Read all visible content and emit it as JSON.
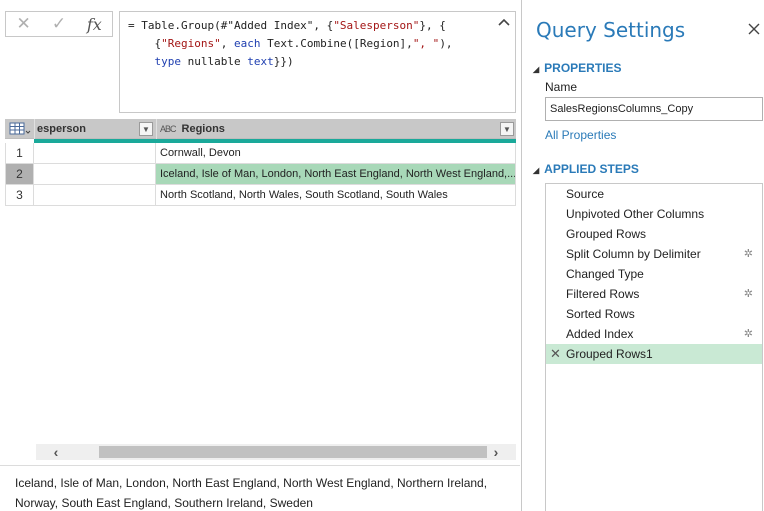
{
  "formula_bar": {
    "cancel_icon": "✕",
    "commit_icon": "✓",
    "fx_label": "fx",
    "line1_a": "= Table.Group(#\"Added Index\", {",
    "line1_str": "\"Salesperson\"",
    "line1_b": "}, {",
    "line2_indent": "    {",
    "line2_str1": "\"Regions\"",
    "line2_sep": ", ",
    "line2_kw": "each",
    "line2_mid": " Text.Combine([Region],",
    "line2_str2": "\", \"",
    "line2_end": "),",
    "line3_indent": "    ",
    "line3_kw1": "type",
    "line3_mid": " nullable ",
    "line3_kw2": "text",
    "line3_end": "}})"
  },
  "grid": {
    "columns": [
      {
        "label": "esperson",
        "type_icon": ""
      },
      {
        "label": "Regions",
        "type_icon": "ABC"
      }
    ],
    "rows": [
      {
        "num": "1",
        "salesperson": "",
        "regions": "Cornwall, Devon"
      },
      {
        "num": "2",
        "salesperson": "",
        "regions": "Iceland, Isle of Man, London, North East England, North West England,..."
      },
      {
        "num": "3",
        "salesperson": "",
        "regions": "North Scotland, North Wales, South Scotland, South Wales"
      }
    ],
    "selected_row": 2
  },
  "preview": {
    "line1": "Iceland, Isle of Man, London, North East England, North West England, Northern Ireland,",
    "line2": "Norway, South East England, Southern Ireland, Sweden"
  },
  "query_settings": {
    "title": "Query Settings",
    "properties_heading": "PROPERTIES",
    "name_label": "Name",
    "name_value": "SalesRegionsColumns_Copy",
    "all_properties_link": "All Properties",
    "applied_steps_heading": "APPLIED STEPS",
    "steps": [
      {
        "label": "Source",
        "gear": false
      },
      {
        "label": "Unpivoted Other Columns",
        "gear": false
      },
      {
        "label": "Grouped Rows",
        "gear": false
      },
      {
        "label": "Split Column by Delimiter",
        "gear": true
      },
      {
        "label": "Changed Type",
        "gear": false
      },
      {
        "label": "Filtered Rows",
        "gear": true
      },
      {
        "label": "Sorted Rows",
        "gear": false
      },
      {
        "label": "Added Index",
        "gear": true
      },
      {
        "label": "Grouped Rows1",
        "gear": false,
        "active": true
      }
    ]
  },
  "colors": {
    "accent": "#2a7ab8",
    "quality_bar": "#1aa99a",
    "selected_cell": "#a8d8b8",
    "active_step": "#c9e9d4"
  },
  "icons": {
    "table_menu": "table-icon",
    "dropdown": "chevron-down-icon",
    "close": "close-icon",
    "gear": "gear-icon",
    "delete_step": "delete-icon"
  }
}
